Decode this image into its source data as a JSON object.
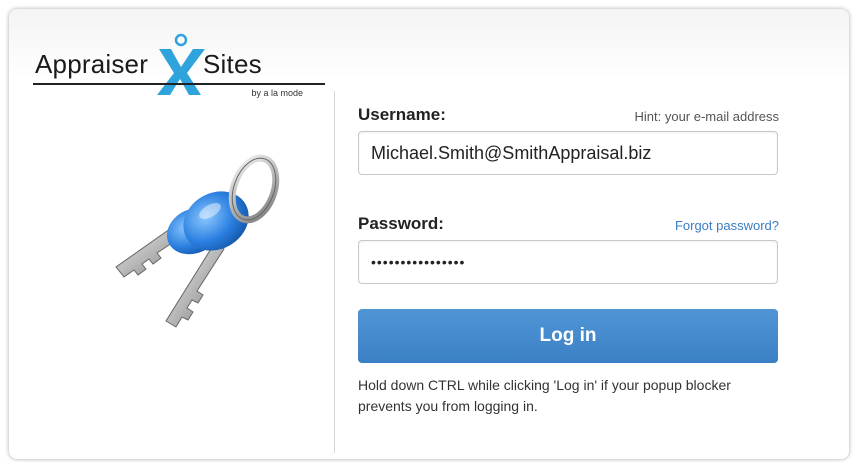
{
  "logo": {
    "word_first": "Appraiser",
    "word_second": "Sites",
    "byline": "by a la mode",
    "accent_color": "#2ea3dc"
  },
  "form": {
    "username": {
      "label": "Username:",
      "hint": "Hint: your e-mail address",
      "value": "Michael.Smith@SmithAppraisal.biz"
    },
    "password": {
      "label": "Password:",
      "forgot_link": "Forgot password?",
      "value": "••••••••••••••••"
    },
    "login_button": "Log in",
    "note": "Hold down CTRL while clicking 'Log in' if your popup blocker prevents you from logging in."
  },
  "icons": {
    "keys": "keys-icon"
  },
  "colors": {
    "button": "#4a8fd2",
    "link": "#3a7dc6"
  }
}
